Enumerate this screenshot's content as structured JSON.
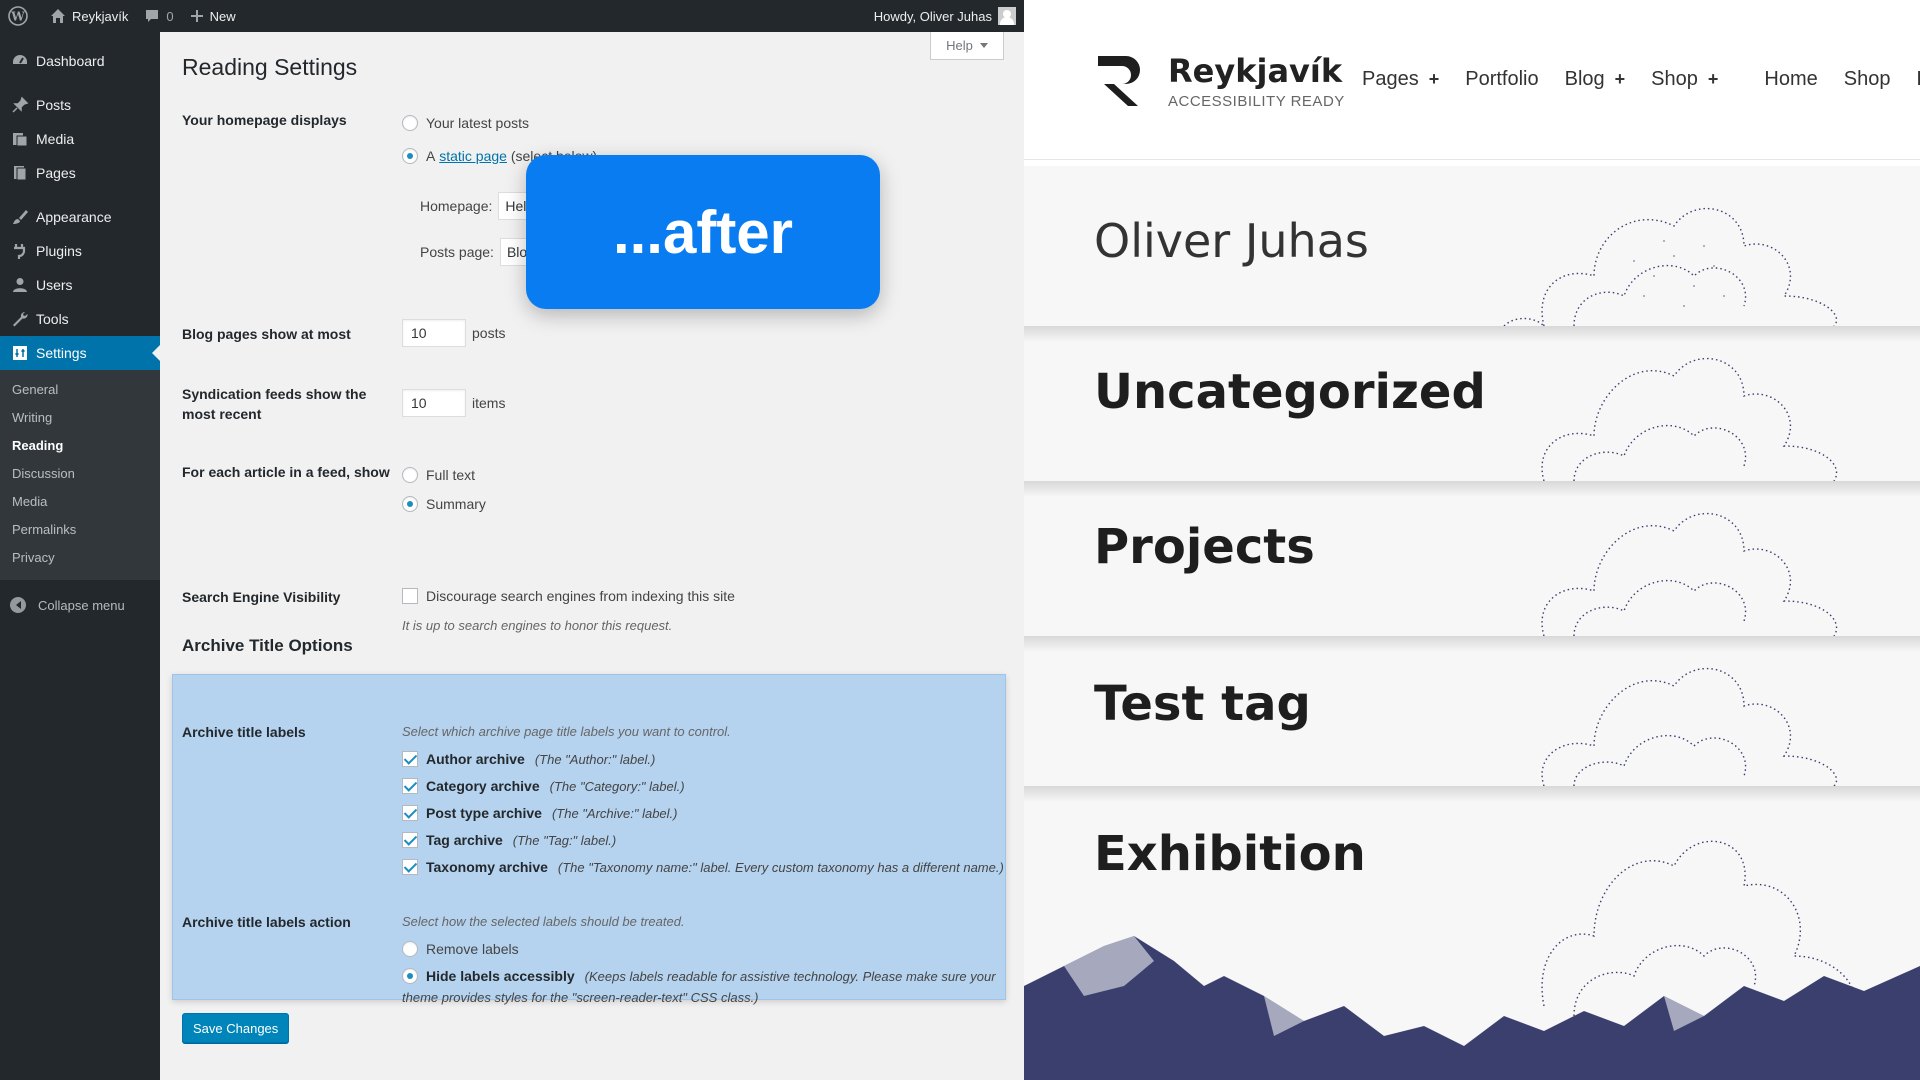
{
  "adminbar": {
    "site_name": "Reykjavík",
    "comments_count": "0",
    "new_label": "New",
    "howdy": "Howdy, Oliver Juhas"
  },
  "sidebar": {
    "items": [
      {
        "label": "Dashboard",
        "icon": "dashboard-icon"
      },
      {
        "label": "Posts",
        "icon": "pin-icon"
      },
      {
        "label": "Media",
        "icon": "media-icon"
      },
      {
        "label": "Pages",
        "icon": "pages-icon"
      },
      {
        "label": "Appearance",
        "icon": "brush-icon"
      },
      {
        "label": "Plugins",
        "icon": "plug-icon"
      },
      {
        "label": "Users",
        "icon": "user-icon"
      },
      {
        "label": "Tools",
        "icon": "wrench-icon"
      },
      {
        "label": "Settings",
        "icon": "settings-icon"
      }
    ],
    "submenu": [
      "General",
      "Writing",
      "Reading",
      "Discussion",
      "Media",
      "Permalinks",
      "Privacy"
    ],
    "collapse": "Collapse menu"
  },
  "main": {
    "help": "Help",
    "title": "Reading Settings",
    "homepage_displays": {
      "label": "Your homepage displays",
      "opt_latest": "Your latest posts",
      "opt_static_prefix": "A",
      "opt_static_link": "static page",
      "opt_static_suffix": "(select below)",
      "homepage_label": "Homepage:",
      "homepage_value": "Hel",
      "posts_page_label": "Posts page:",
      "posts_page_value": "Blog"
    },
    "blog_pages": {
      "label": "Blog pages show at most",
      "value": "10",
      "unit": "posts"
    },
    "syndication": {
      "label_line1": "Syndication feeds show the",
      "label_line2": "most recent",
      "value": "10",
      "unit": "items"
    },
    "feed_article": {
      "label": "For each article in a feed, show",
      "opt_full": "Full text",
      "opt_summary": "Summary"
    },
    "search_visibility": {
      "label": "Search Engine Visibility",
      "checkbox": "Discourage search engines from indexing this site",
      "desc": "It is up to search engines to honor this request."
    },
    "archive": {
      "heading": "Archive Title Options",
      "labels_label": "Archive title labels",
      "labels_desc": "Select which archive page title labels you want to control.",
      "items": [
        {
          "name": "Author archive",
          "note": "(The \"Author:\" label.)"
        },
        {
          "name": "Category archive",
          "note": "(The \"Category:\" label.)"
        },
        {
          "name": "Post type archive",
          "note": "(The \"Archive:\" label.)"
        },
        {
          "name": "Tag archive",
          "note": "(The \"Tag:\" label.)"
        },
        {
          "name": "Taxonomy archive",
          "note": "(The \"Taxonomy name:\" label. Every custom taxonomy has a different name.)"
        }
      ],
      "action_label": "Archive title labels action",
      "action_desc": "Select how the selected labels should be treated.",
      "opt_remove": "Remove labels",
      "opt_hide": "Hide labels accessibly",
      "opt_hide_note_line1": "(Keeps labels readable for assistive technology. Please make sure your",
      "opt_hide_note_line2": "theme provides styles for the \"screen-reader-text\" CSS class.)"
    },
    "save": "Save Changes"
  },
  "overlay": {
    "text": "...after"
  },
  "preview": {
    "site_title": "Reykjavík",
    "tagline": "ACCESSIBILITY READY",
    "nav": [
      "Pages",
      "Portfolio",
      "Blog",
      "Shop",
      "Home",
      "Shop",
      "RT"
    ],
    "bands": [
      "Oliver Juhas",
      "Uncategorized",
      "Projects",
      "Test tag",
      "Exhibition"
    ]
  },
  "colors": {
    "admin_dark": "#23282d",
    "accent": "#0073aa",
    "highlight_box": "#b5d3ef",
    "overlay_blue": "#0a7cf2",
    "illustration": "#3b3f6e"
  }
}
